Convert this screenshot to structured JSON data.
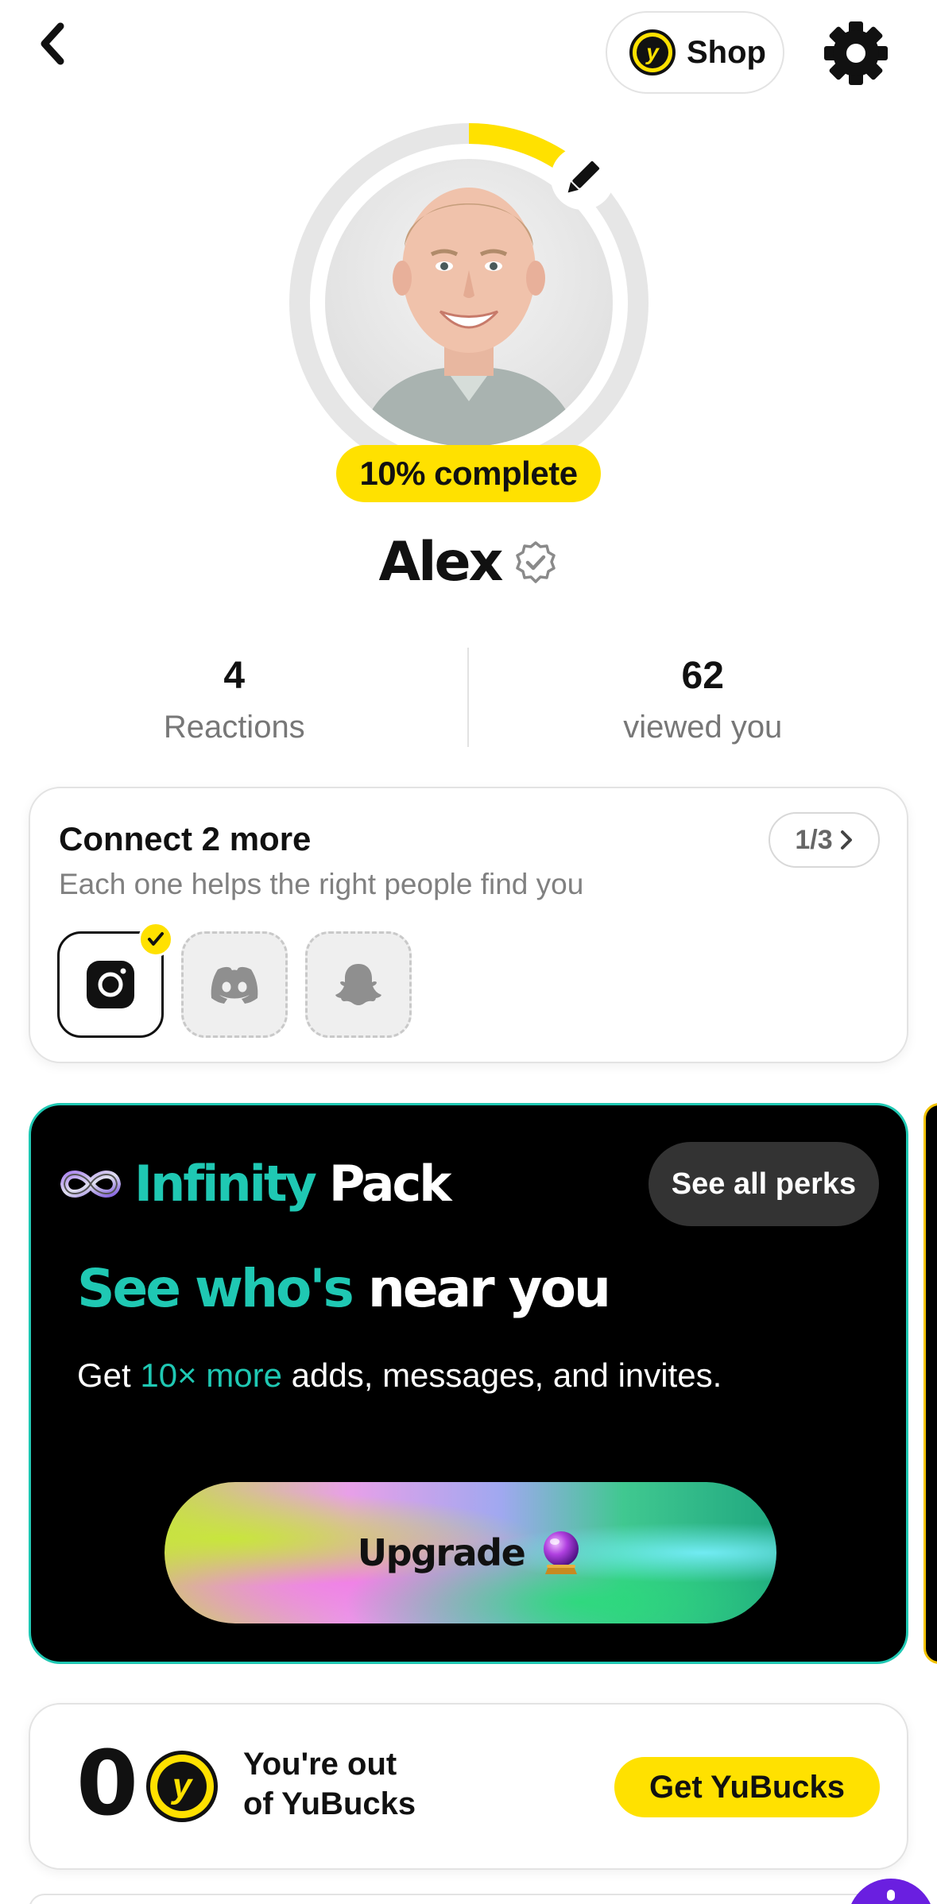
{
  "nav": {
    "back_icon": "chevron-left-icon",
    "shop_label": "Shop",
    "settings_icon": "gear-icon"
  },
  "profile": {
    "completion_label": "10% complete",
    "completion_fraction": 0.1,
    "name": "Alex",
    "verified_icon": "verified-badge-icon",
    "edit_icon": "pencil-icon"
  },
  "stats": [
    {
      "value": "4",
      "label": "Reactions"
    },
    {
      "value": "62",
      "label": "viewed you"
    }
  ],
  "connect": {
    "title": "Connect 2 more",
    "subtitle": "Each one helps the right people find you",
    "progress": "1/3",
    "accounts": [
      {
        "name": "Instagram",
        "icon": "instagram-icon",
        "connected": true
      },
      {
        "name": "Discord",
        "icon": "discord-icon",
        "connected": false
      },
      {
        "name": "Snapchat",
        "icon": "snapchat-icon",
        "connected": false
      }
    ]
  },
  "infinity": {
    "brand_accent": "Infinity",
    "brand_rest": "Pack",
    "perks_label": "See all perks",
    "headline_accent": "See who's",
    "headline_rest": "near you",
    "desc_prefix": "Get",
    "desc_accent": "10× more",
    "desc_suffix": "adds, messages, and invites.",
    "upgrade_label": "Upgrade",
    "upgrade_icon": "crystal-ball-icon",
    "accent_color": "#1fc8b3"
  },
  "yubucks": {
    "count": "0",
    "line1": "You're out",
    "line2": "of YuBucks",
    "button_label": "Get YuBucks",
    "coin_letter": "y",
    "accent_color": "#ffe100"
  }
}
